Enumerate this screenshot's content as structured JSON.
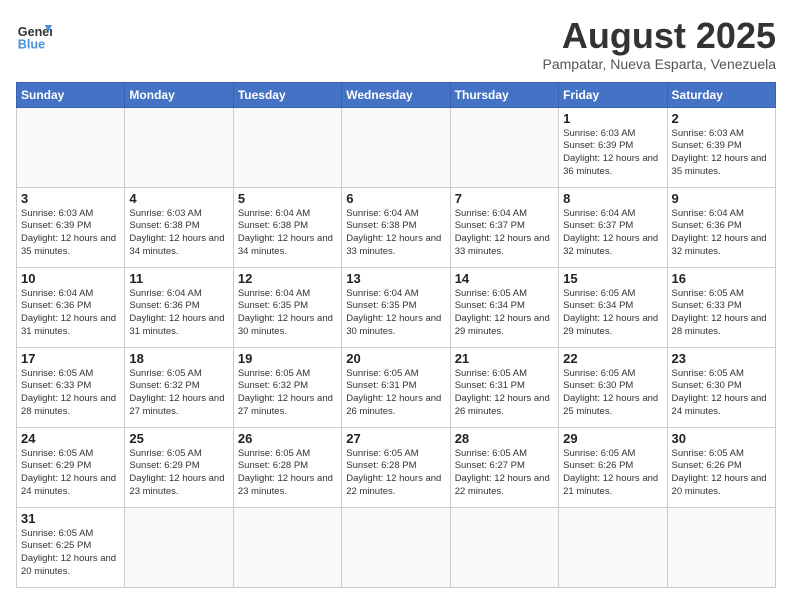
{
  "header": {
    "logo_general": "General",
    "logo_blue": "Blue",
    "title": "August 2025",
    "subtitle": "Pampatar, Nueva Esparta, Venezuela"
  },
  "weekdays": [
    "Sunday",
    "Monday",
    "Tuesday",
    "Wednesday",
    "Thursday",
    "Friday",
    "Saturday"
  ],
  "weeks": [
    [
      {
        "day": "",
        "info": ""
      },
      {
        "day": "",
        "info": ""
      },
      {
        "day": "",
        "info": ""
      },
      {
        "day": "",
        "info": ""
      },
      {
        "day": "",
        "info": ""
      },
      {
        "day": "1",
        "info": "Sunrise: 6:03 AM\nSunset: 6:39 PM\nDaylight: 12 hours and 36 minutes."
      },
      {
        "day": "2",
        "info": "Sunrise: 6:03 AM\nSunset: 6:39 PM\nDaylight: 12 hours and 35 minutes."
      }
    ],
    [
      {
        "day": "3",
        "info": "Sunrise: 6:03 AM\nSunset: 6:39 PM\nDaylight: 12 hours and 35 minutes."
      },
      {
        "day": "4",
        "info": "Sunrise: 6:03 AM\nSunset: 6:38 PM\nDaylight: 12 hours and 34 minutes."
      },
      {
        "day": "5",
        "info": "Sunrise: 6:04 AM\nSunset: 6:38 PM\nDaylight: 12 hours and 34 minutes."
      },
      {
        "day": "6",
        "info": "Sunrise: 6:04 AM\nSunset: 6:38 PM\nDaylight: 12 hours and 33 minutes."
      },
      {
        "day": "7",
        "info": "Sunrise: 6:04 AM\nSunset: 6:37 PM\nDaylight: 12 hours and 33 minutes."
      },
      {
        "day": "8",
        "info": "Sunrise: 6:04 AM\nSunset: 6:37 PM\nDaylight: 12 hours and 32 minutes."
      },
      {
        "day": "9",
        "info": "Sunrise: 6:04 AM\nSunset: 6:36 PM\nDaylight: 12 hours and 32 minutes."
      }
    ],
    [
      {
        "day": "10",
        "info": "Sunrise: 6:04 AM\nSunset: 6:36 PM\nDaylight: 12 hours and 31 minutes."
      },
      {
        "day": "11",
        "info": "Sunrise: 6:04 AM\nSunset: 6:36 PM\nDaylight: 12 hours and 31 minutes."
      },
      {
        "day": "12",
        "info": "Sunrise: 6:04 AM\nSunset: 6:35 PM\nDaylight: 12 hours and 30 minutes."
      },
      {
        "day": "13",
        "info": "Sunrise: 6:04 AM\nSunset: 6:35 PM\nDaylight: 12 hours and 30 minutes."
      },
      {
        "day": "14",
        "info": "Sunrise: 6:05 AM\nSunset: 6:34 PM\nDaylight: 12 hours and 29 minutes."
      },
      {
        "day": "15",
        "info": "Sunrise: 6:05 AM\nSunset: 6:34 PM\nDaylight: 12 hours and 29 minutes."
      },
      {
        "day": "16",
        "info": "Sunrise: 6:05 AM\nSunset: 6:33 PM\nDaylight: 12 hours and 28 minutes."
      }
    ],
    [
      {
        "day": "17",
        "info": "Sunrise: 6:05 AM\nSunset: 6:33 PM\nDaylight: 12 hours and 28 minutes."
      },
      {
        "day": "18",
        "info": "Sunrise: 6:05 AM\nSunset: 6:32 PM\nDaylight: 12 hours and 27 minutes."
      },
      {
        "day": "19",
        "info": "Sunrise: 6:05 AM\nSunset: 6:32 PM\nDaylight: 12 hours and 27 minutes."
      },
      {
        "day": "20",
        "info": "Sunrise: 6:05 AM\nSunset: 6:31 PM\nDaylight: 12 hours and 26 minutes."
      },
      {
        "day": "21",
        "info": "Sunrise: 6:05 AM\nSunset: 6:31 PM\nDaylight: 12 hours and 26 minutes."
      },
      {
        "day": "22",
        "info": "Sunrise: 6:05 AM\nSunset: 6:30 PM\nDaylight: 12 hours and 25 minutes."
      },
      {
        "day": "23",
        "info": "Sunrise: 6:05 AM\nSunset: 6:30 PM\nDaylight: 12 hours and 24 minutes."
      }
    ],
    [
      {
        "day": "24",
        "info": "Sunrise: 6:05 AM\nSunset: 6:29 PM\nDaylight: 12 hours and 24 minutes."
      },
      {
        "day": "25",
        "info": "Sunrise: 6:05 AM\nSunset: 6:29 PM\nDaylight: 12 hours and 23 minutes."
      },
      {
        "day": "26",
        "info": "Sunrise: 6:05 AM\nSunset: 6:28 PM\nDaylight: 12 hours and 23 minutes."
      },
      {
        "day": "27",
        "info": "Sunrise: 6:05 AM\nSunset: 6:28 PM\nDaylight: 12 hours and 22 minutes."
      },
      {
        "day": "28",
        "info": "Sunrise: 6:05 AM\nSunset: 6:27 PM\nDaylight: 12 hours and 22 minutes."
      },
      {
        "day": "29",
        "info": "Sunrise: 6:05 AM\nSunset: 6:26 PM\nDaylight: 12 hours and 21 minutes."
      },
      {
        "day": "30",
        "info": "Sunrise: 6:05 AM\nSunset: 6:26 PM\nDaylight: 12 hours and 20 minutes."
      }
    ],
    [
      {
        "day": "31",
        "info": "Sunrise: 6:05 AM\nSunset: 6:25 PM\nDaylight: 12 hours and 20 minutes."
      },
      {
        "day": "",
        "info": ""
      },
      {
        "day": "",
        "info": ""
      },
      {
        "day": "",
        "info": ""
      },
      {
        "day": "",
        "info": ""
      },
      {
        "day": "",
        "info": ""
      },
      {
        "day": "",
        "info": ""
      }
    ]
  ]
}
